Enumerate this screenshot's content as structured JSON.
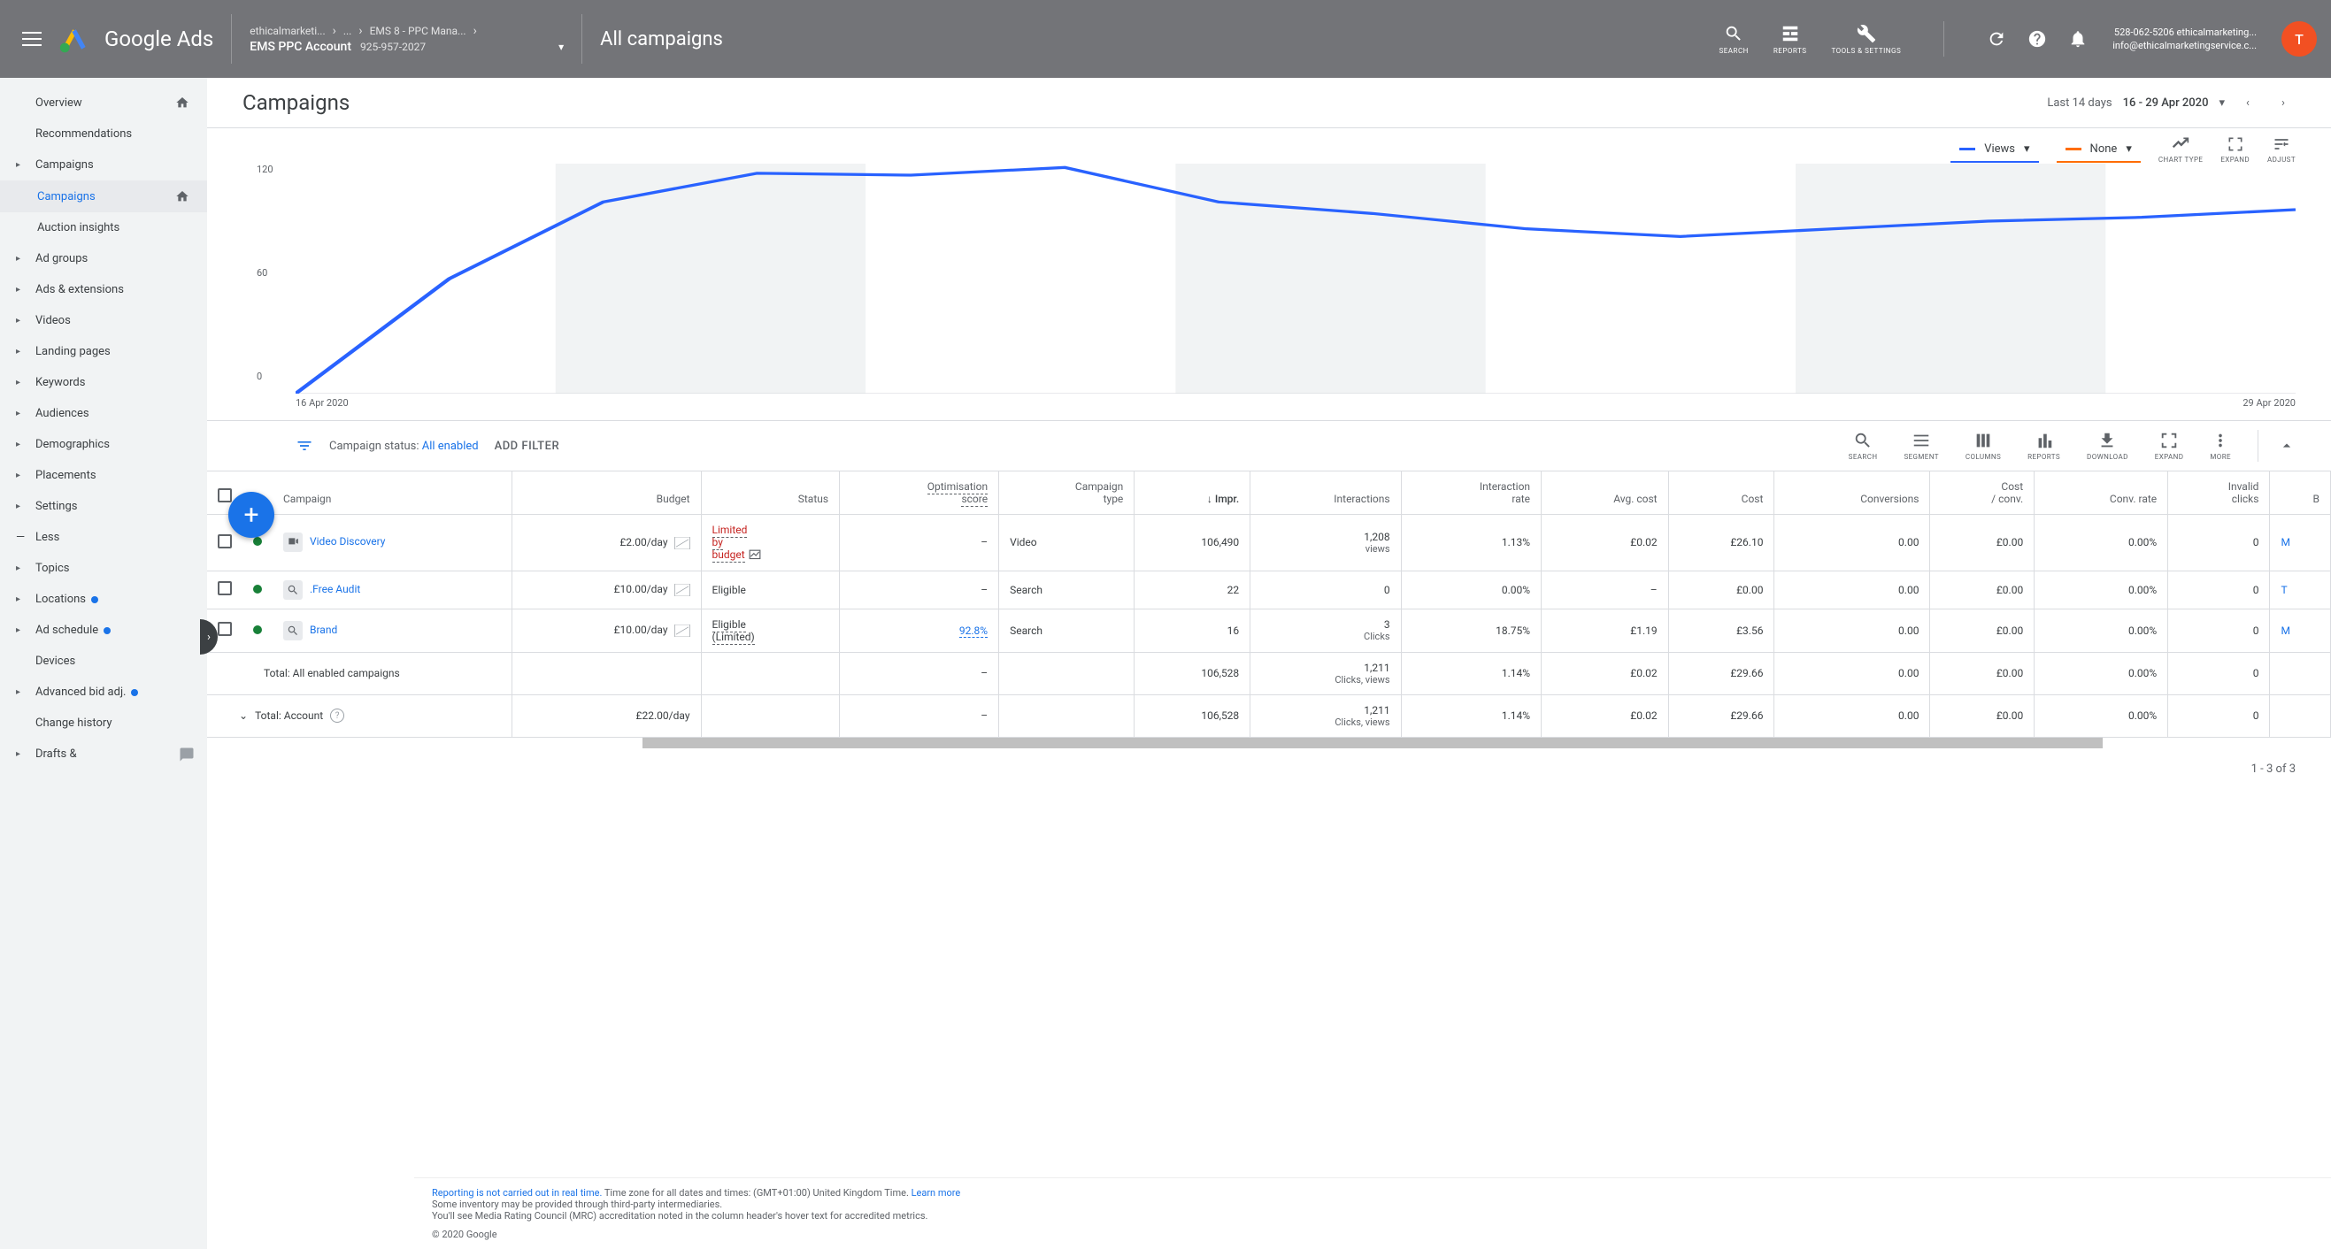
{
  "header": {
    "logo_text": "Google Ads",
    "breadcrumb": [
      "ethicalmarketi...",
      "...",
      "EMS 8 - PPC Mana..."
    ],
    "account_name": "EMS PPC Account",
    "account_id": "925-957-2027",
    "page_title": "All campaigns",
    "tools": [
      {
        "name": "search",
        "label": "SEARCH"
      },
      {
        "name": "reports",
        "label": "REPORTS"
      },
      {
        "name": "tools",
        "label": "TOOLS & SETTINGS"
      }
    ],
    "user": {
      "line1": "528-062-5206 ethicalmarketing...",
      "line2": "info@ethicalmarketingservice.c...",
      "avatar_letter": "T"
    }
  },
  "date_picker": {
    "prefix": "Last 14 days",
    "range": "16 - 29 Apr 2020"
  },
  "sidebar": {
    "items": [
      {
        "label": "Overview",
        "arrow": false,
        "home": true
      },
      {
        "label": "Recommendations",
        "arrow": false
      },
      {
        "label": "Campaigns",
        "arrow": true,
        "expanded": true
      },
      {
        "label": "Campaigns",
        "sub": true,
        "selected": true,
        "home": true
      },
      {
        "label": "Auction insights",
        "sub": true
      },
      {
        "label": "Ad groups",
        "arrow": true
      },
      {
        "label": "Ads & extensions",
        "arrow": true
      },
      {
        "label": "Videos",
        "arrow": true
      },
      {
        "label": "Landing pages",
        "arrow": true
      },
      {
        "label": "Keywords",
        "arrow": true
      },
      {
        "label": "Audiences",
        "arrow": true
      },
      {
        "label": "Demographics",
        "arrow": true
      },
      {
        "label": "Placements",
        "arrow": true
      },
      {
        "label": "Settings",
        "arrow": true
      },
      {
        "label": "Less",
        "less": true
      },
      {
        "label": "Topics",
        "arrow": true
      },
      {
        "label": "Locations",
        "arrow": true,
        "dot": true
      },
      {
        "label": "Ad schedule",
        "arrow": true,
        "dot": true
      },
      {
        "label": "Devices",
        "arrow": false
      },
      {
        "label": "Advanced bid adj.",
        "arrow": true,
        "dot": true
      },
      {
        "label": "Change history",
        "arrow": false
      },
      {
        "label": "Drafts &",
        "arrow": true,
        "chat": true
      }
    ]
  },
  "main_title": "Campaigns",
  "chart": {
    "metric1": "Views",
    "metric2": "None",
    "tools": [
      {
        "name": "chart-type",
        "label": "CHART TYPE"
      },
      {
        "name": "expand",
        "label": "EXPAND"
      },
      {
        "name": "adjust",
        "label": "ADJUST"
      }
    ],
    "y_ticks": [
      "120",
      "60",
      "0"
    ],
    "x_start": "16 Apr 2020",
    "x_end": "29 Apr 2020"
  },
  "chart_data": {
    "type": "line",
    "x": [
      "16 Apr",
      "17 Apr",
      "18 Apr",
      "19 Apr",
      "20 Apr",
      "21 Apr",
      "22 Apr",
      "23 Apr",
      "24 Apr",
      "25 Apr",
      "26 Apr",
      "27 Apr",
      "28 Apr",
      "29 Apr"
    ],
    "series": [
      {
        "name": "Views",
        "values": [
          0,
          60,
          100,
          115,
          114,
          118,
          100,
          94,
          86,
          82,
          86,
          90,
          92,
          96
        ]
      }
    ],
    "ylim": [
      0,
      120
    ],
    "title": "",
    "xlabel": "",
    "ylabel": ""
  },
  "filter": {
    "prefix": "Campaign status:",
    "value": "All enabled",
    "add_filter": "ADD FILTER"
  },
  "table_tools": [
    {
      "name": "search",
      "label": "SEARCH"
    },
    {
      "name": "segment",
      "label": "SEGMENT"
    },
    {
      "name": "columns",
      "label": "COLUMNS"
    },
    {
      "name": "reports",
      "label": "REPORTS"
    },
    {
      "name": "download",
      "label": "DOWNLOAD"
    },
    {
      "name": "expand",
      "label": "EXPAND"
    },
    {
      "name": "more",
      "label": "MORE"
    }
  ],
  "columns": [
    "Campaign",
    "Budget",
    "Status",
    "Optimisation score",
    "Campaign type",
    "Impr.",
    "Interactions",
    "Interaction rate",
    "Avg. cost",
    "Cost",
    "Conversions",
    "Cost / conv.",
    "Conv. rate",
    "Invalid clicks",
    "B"
  ],
  "rows": [
    {
      "name": "Video Discovery",
      "type_icon": "video",
      "budget": "£2.00/day",
      "status": "Limited by budget",
      "status_limited": true,
      "opt_score": "–",
      "ctype": "Video",
      "impr": "106,490",
      "interactions": "1,208",
      "interactions_sub": "views",
      "rate": "1.13%",
      "avg_cost": "£0.02",
      "cost": "£26.10",
      "conv": "0.00",
      "cost_conv": "£0.00",
      "conv_rate": "0.00%",
      "invalid": "0",
      "extra": "M"
    },
    {
      "name": ".Free Audit",
      "type_icon": "search",
      "budget": "£10.00/day",
      "status": "Eligible",
      "opt_score": "–",
      "ctype": "Search",
      "impr": "22",
      "interactions": "0",
      "interactions_sub": "",
      "rate": "0.00%",
      "avg_cost": "–",
      "cost": "£0.00",
      "conv": "0.00",
      "cost_conv": "£0.00",
      "conv_rate": "0.00%",
      "invalid": "0",
      "extra": "T"
    },
    {
      "name": "Brand",
      "type_icon": "search",
      "budget": "£10.00/day",
      "status": "Eligible (Limited)",
      "opt_score": "92.8%",
      "opt_link": true,
      "ctype": "Search",
      "impr": "16",
      "interactions": "3",
      "interactions_sub": "Clicks",
      "rate": "18.75%",
      "avg_cost": "£1.19",
      "cost": "£3.56",
      "conv": "0.00",
      "cost_conv": "£0.00",
      "conv_rate": "0.00%",
      "invalid": "0",
      "extra": "M"
    }
  ],
  "totals": [
    {
      "label": "Total: All enabled campaigns",
      "budget": "",
      "opt_score": "–",
      "impr": "106,528",
      "interactions": "1,211",
      "interactions_sub": "Clicks, views",
      "rate": "1.14%",
      "avg_cost": "£0.02",
      "cost": "£29.66",
      "conv": "0.00",
      "cost_conv": "£0.00",
      "conv_rate": "0.00%",
      "invalid": "0"
    },
    {
      "label": "Total: Account",
      "help": true,
      "chevron": true,
      "budget": "£22.00/day",
      "opt_score": "–",
      "impr": "106,528",
      "interactions": "1,211",
      "interactions_sub": "Clicks, views",
      "rate": "1.14%",
      "avg_cost": "£0.02",
      "cost": "£29.66",
      "conv": "0.00",
      "cost_conv": "£0.00",
      "conv_rate": "0.00%",
      "invalid": "0"
    }
  ],
  "pagination": "1 - 3 of 3",
  "footer": {
    "l1_a": "Reporting is not carried out in real time.",
    "l1_b": " Time zone for all dates and times: (GMT+01:00) United Kingdom Time. ",
    "l1_link": "Learn more",
    "l2": "Some inventory may be provided through third-party intermediaries.",
    "l3": "You'll see Media Rating Council (MRC) accreditation noted in the column header's hover text for accredited metrics.",
    "copyright": "© 2020 Google"
  }
}
